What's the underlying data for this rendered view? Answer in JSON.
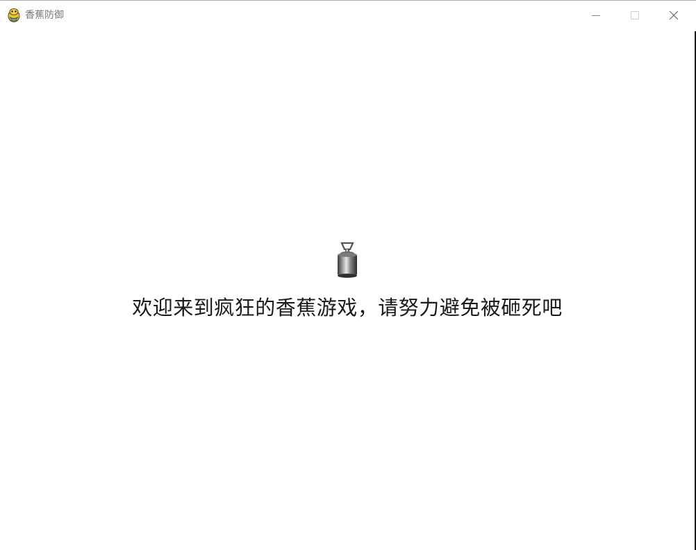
{
  "window": {
    "title": "香蕉防御",
    "app_icon": "pygame-snake-icon",
    "controls": {
      "minimize_icon": "minimize-icon",
      "maximize_icon": "maximize-icon",
      "close_icon": "close-icon"
    }
  },
  "main": {
    "sprite_icon": "weight-icon",
    "welcome_text": "欢迎来到疯狂的香蕉游戏，请努力避免被砸死吧"
  },
  "colors": {
    "background": "#ffffff",
    "title_text": "#7a7a7a",
    "body_text": "#1a1a1a"
  }
}
